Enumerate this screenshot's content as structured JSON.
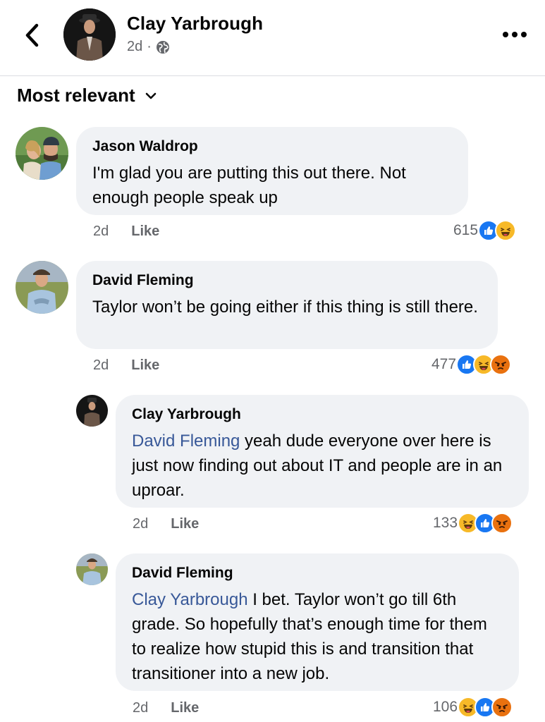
{
  "header": {
    "name": "Clay Yarbrough",
    "time": "2d",
    "separator": "·",
    "privacy_icon": "globe-icon",
    "back_icon": "chevron-left-icon",
    "more_icon": "more-horizontal-icon"
  },
  "sort": {
    "label": "Most relevant",
    "icon": "chevron-down-icon"
  },
  "comments": [
    {
      "author": "Jason Waldrop",
      "text": "I'm glad you are putting this out there. Not enough people speak up",
      "time": "2d",
      "like_label": "Like",
      "reaction_count": "615",
      "reactions": [
        "like",
        "haha"
      ]
    },
    {
      "author": "David Fleming",
      "text": "Taylor won’t be going either if this thing is still there.",
      "time": "2d",
      "like_label": "Like",
      "reaction_count": "477",
      "reactions": [
        "like",
        "haha",
        "angry"
      ]
    },
    {
      "author": "Clay Yarbrough",
      "mention": "David Fleming",
      "text": " yeah dude everyone over here is just now finding out about IT and people are in an uproar.",
      "time": "2d",
      "like_label": "Like",
      "reaction_count": "133",
      "reactions": [
        "haha",
        "like",
        "angry"
      ]
    },
    {
      "author": "David Fleming",
      "mention": "Clay Yarbrough",
      "text": " I bet. Taylor won’t go till 6th grade. So hopefully that’s enough time for them to realize how stupid this is and transition that transitioner into a new job.",
      "time": "2d",
      "like_label": "Like",
      "reaction_count": "106",
      "reactions": [
        "haha",
        "like",
        "angry"
      ]
    }
  ],
  "colors": {
    "like_blue": "#1877f2",
    "mention_blue": "#385898",
    "bubble_gray": "#f0f2f5",
    "meta_gray": "#65676b",
    "haha_yellow": "#f7b928",
    "angry_orange": "#e9710f"
  }
}
